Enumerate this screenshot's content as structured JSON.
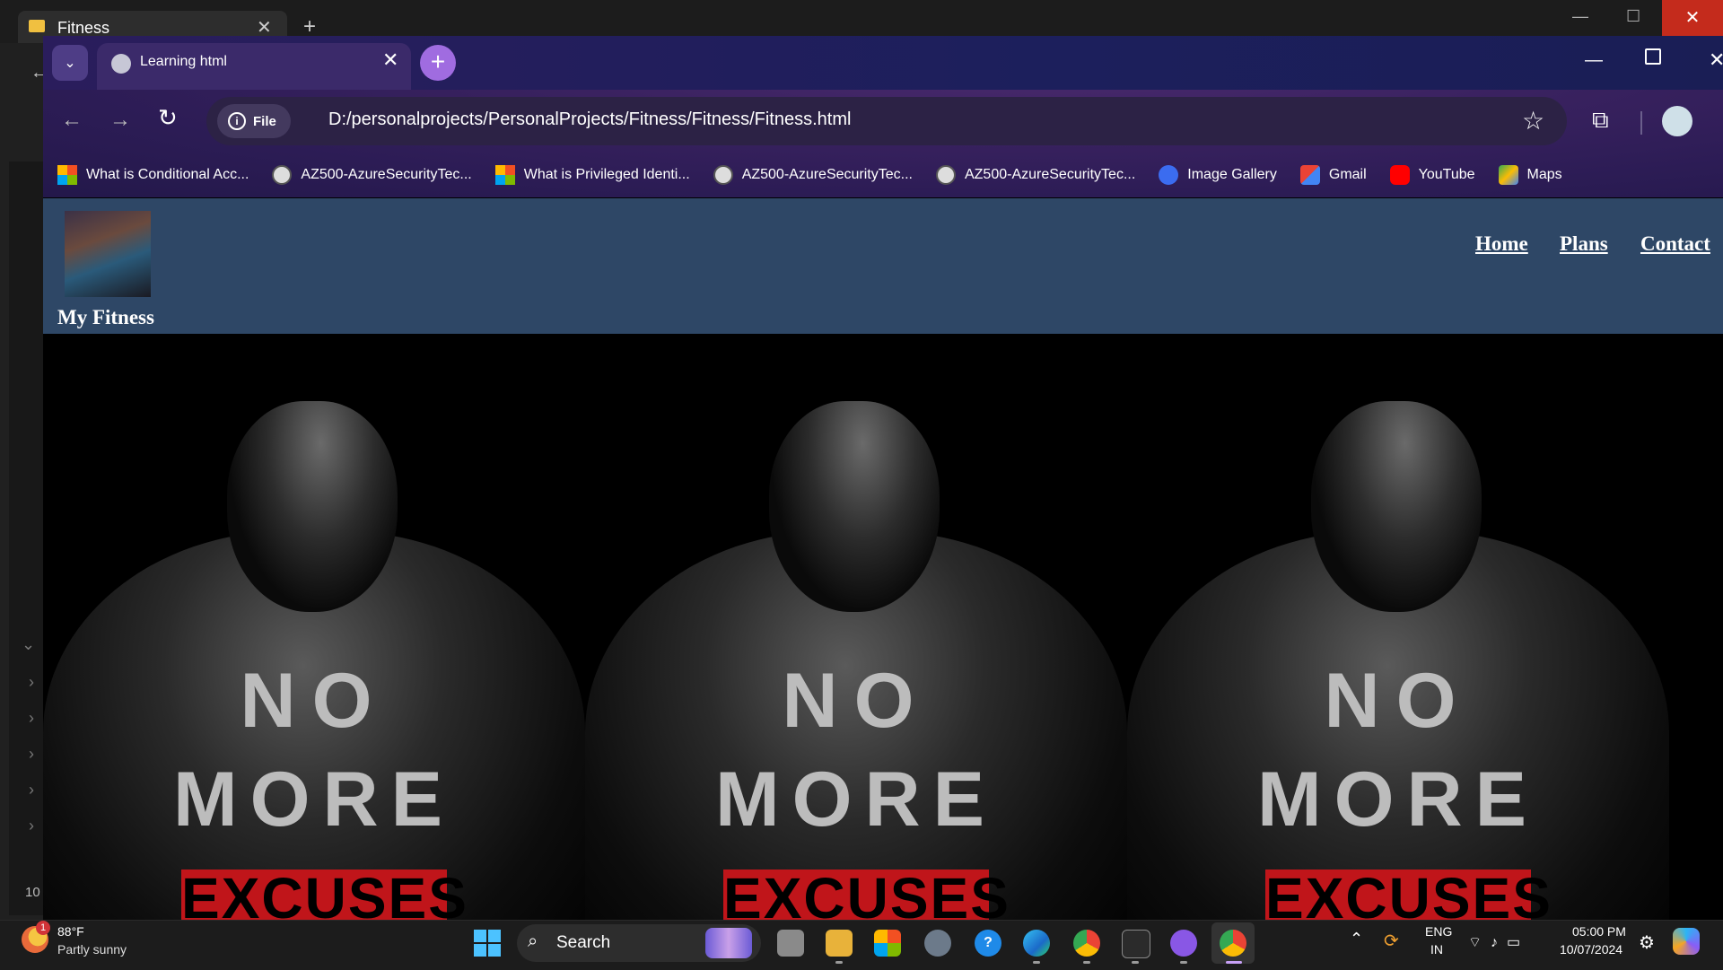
{
  "background_window": {
    "tab_title": "Fitness",
    "close_label": "✕",
    "new_tab_label": "+",
    "sidebar_count": "10"
  },
  "browser": {
    "active_tab_title": "Learning html",
    "tab_close": "✕",
    "new_tab": "+",
    "address": {
      "site_info_label": "File",
      "url": "D:/personalprojects/PersonalProjects/Fitness/Fitness/Fitness.html"
    },
    "bookmarks": [
      {
        "label": "What is Conditional Acc...",
        "icon": "microsoft-icon"
      },
      {
        "label": "AZ500-AzureSecurityTec...",
        "icon": "globe-icon"
      },
      {
        "label": "What is Privileged Identi...",
        "icon": "microsoft-icon"
      },
      {
        "label": "AZ500-AzureSecurityTec...",
        "icon": "globe-icon"
      },
      {
        "label": "AZ500-AzureSecurityTec...",
        "icon": "globe-icon"
      },
      {
        "label": "Image Gallery",
        "icon": "droplet-icon"
      },
      {
        "label": "Gmail",
        "icon": "gmail-icon"
      },
      {
        "label": "YouTube",
        "icon": "youtube-icon"
      },
      {
        "label": "Maps",
        "icon": "maps-icon"
      }
    ]
  },
  "site": {
    "title": "My Fitness",
    "nav": {
      "home": "Home",
      "plans": "Plans",
      "contact": "Contact"
    },
    "hero": {
      "line1": "NO",
      "line2": "MORE",
      "line3": "EXCUSES"
    }
  },
  "taskbar": {
    "weather_temp": "88°F",
    "weather_condition": "Partly sunny",
    "weather_badge": "1",
    "search_label": "Search",
    "language_line1": "ENG",
    "language_line2": "IN",
    "time": "05:00 PM",
    "date": "10/07/2024"
  }
}
